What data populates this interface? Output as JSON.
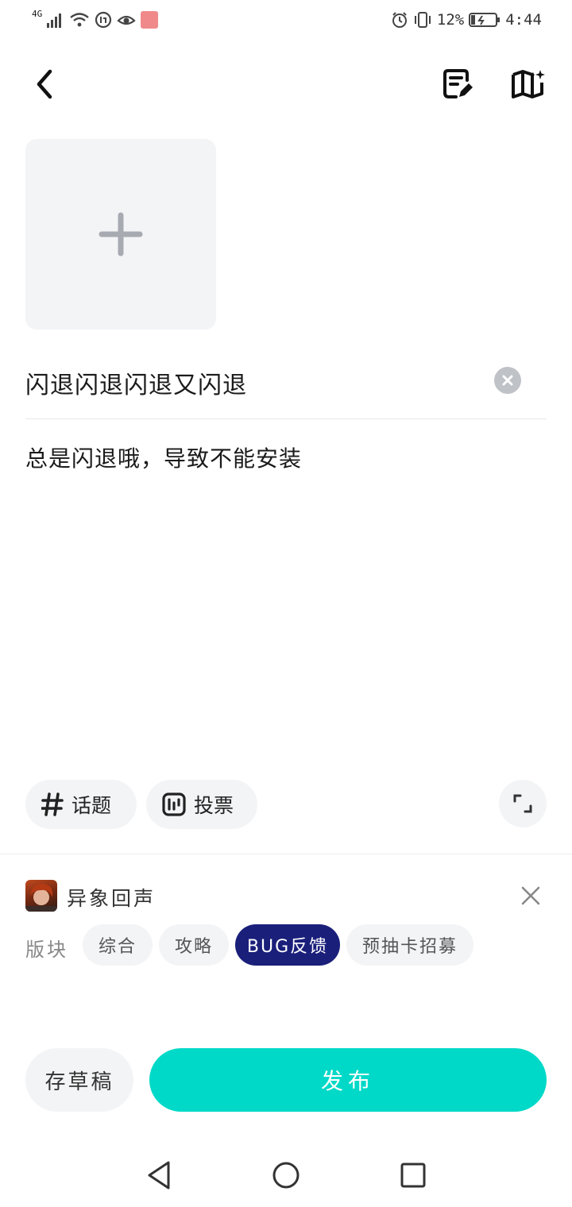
{
  "status_bar": {
    "network": "4G",
    "battery_percent": "12%",
    "time": "4:44"
  },
  "post": {
    "title": "闪退闪退闪退又闪退",
    "body": "总是闪退哦，导致不能安装"
  },
  "toolbar": {
    "topic_label": "话题",
    "vote_label": "投票"
  },
  "game": {
    "name": "异象回声"
  },
  "sections": {
    "label": "版块",
    "tags": [
      {
        "label": "综合",
        "active": false
      },
      {
        "label": "攻略",
        "active": false
      },
      {
        "label": "BUG反馈",
        "active": true
      },
      {
        "label": "预抽卡招募",
        "active": false
      }
    ]
  },
  "actions": {
    "save_draft_label": "存草稿",
    "publish_label": "发布"
  },
  "colors": {
    "publish": "#00d9c8",
    "active_tag": "#1a1f7a",
    "chip_bg": "#f3f4f6"
  }
}
